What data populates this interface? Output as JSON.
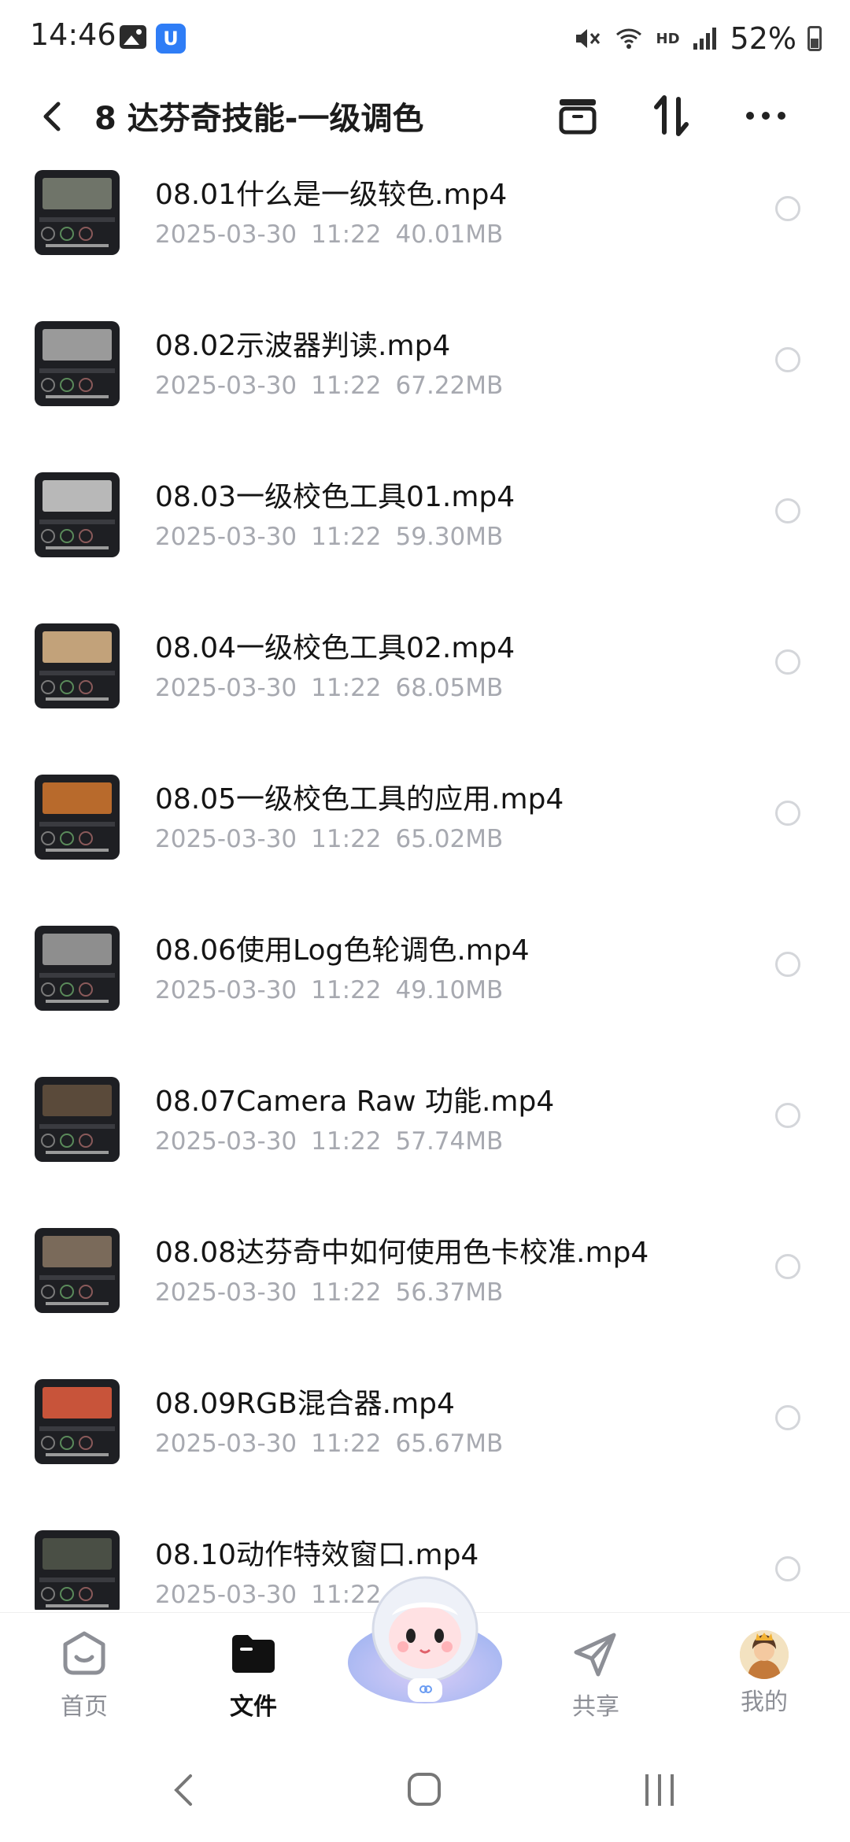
{
  "status_bar": {
    "time": "14:46",
    "battery": "52%",
    "network_badge": "HD",
    "icons": [
      "gallery-icon",
      "shield-app-icon",
      "mute-icon",
      "wifi-icon",
      "signal-icon",
      "battery-icon"
    ]
  },
  "header": {
    "title": "8 达芬奇技能-一级调色",
    "icons": [
      "back-arrow-icon",
      "archive-box-icon",
      "sort-icon",
      "more-icon"
    ]
  },
  "files": [
    {
      "name": "08.01什么是一级较色.mp4",
      "date": "2025-03-30",
      "time": "11:22",
      "size": "40.01MB",
      "thumb_color": "#6f7469"
    },
    {
      "name": "08.02示波器判读.mp4",
      "date": "2025-03-30",
      "time": "11:22",
      "size": "67.22MB",
      "thumb_color": "#9a9a9a"
    },
    {
      "name": "08.03一级校色工具01.mp4",
      "date": "2025-03-30",
      "time": "11:22",
      "size": "59.30MB",
      "thumb_color": "#b8b8b8"
    },
    {
      "name": "08.04一级校色工具02.mp4",
      "date": "2025-03-30",
      "time": "11:22",
      "size": "68.05MB",
      "thumb_color": "#c2a27a"
    },
    {
      "name": "08.05一级校色工具的应用.mp4",
      "date": "2025-03-30",
      "time": "11:22",
      "size": "65.02MB",
      "thumb_color": "#b86a2c"
    },
    {
      "name": "08.06使用Log色轮调色.mp4",
      "date": "2025-03-30",
      "time": "11:22",
      "size": "49.10MB",
      "thumb_color": "#8e8e8e"
    },
    {
      "name": "08.07Camera Raw 功能.mp4",
      "date": "2025-03-30",
      "time": "11:22",
      "size": "57.74MB",
      "thumb_color": "#5a4a3a"
    },
    {
      "name": "08.08达芬奇中如何使用色卡校准.mp4",
      "date": "2025-03-30",
      "time": "11:22",
      "size": "56.37MB",
      "thumb_color": "#7a6a5a"
    },
    {
      "name": "08.09RGB混合器.mp4",
      "date": "2025-03-30",
      "time": "11:22",
      "size": "65.67MB",
      "thumb_color": "#c8543a"
    },
    {
      "name": "08.10动作特效窗口.mp4",
      "date": "2025-03-30",
      "time": "11:22",
      "size": "",
      "thumb_color": "#4a4f45"
    }
  ],
  "tabs": [
    {
      "label": "首页",
      "icon": "home-icon",
      "active": false
    },
    {
      "label": "文件",
      "icon": "folder-icon",
      "active": true
    },
    {
      "label": "共享",
      "icon": "share-send-icon",
      "active": false
    },
    {
      "label": "我的",
      "icon": "avatar",
      "active": false
    }
  ],
  "colors": {
    "meta_text": "#a7a9b0",
    "title_text": "#1c1c1c",
    "radio_border": "#d4d6da",
    "tab_inactive": "#8d8f96",
    "tab_active": "#111111"
  }
}
